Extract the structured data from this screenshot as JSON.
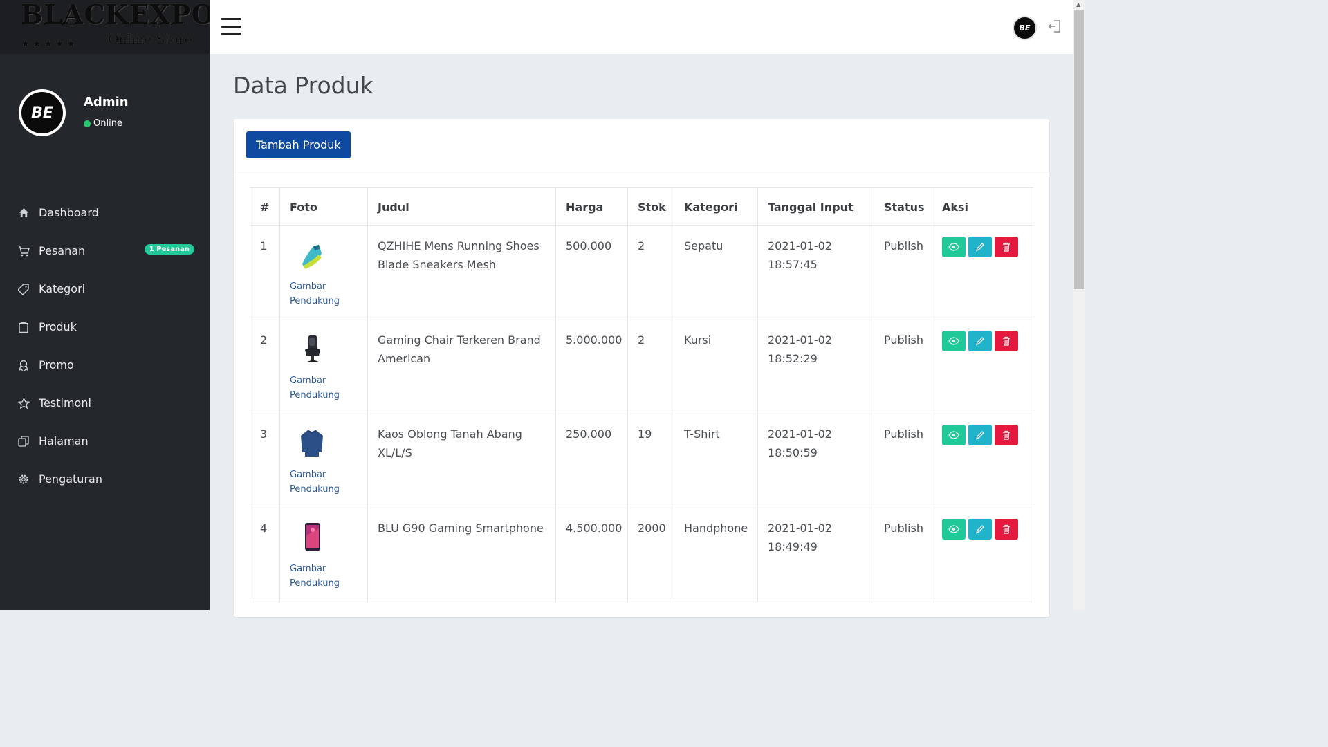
{
  "brand": {
    "main": "BLACKEXPO",
    "stars": "★★★★★",
    "sub": "Online Store"
  },
  "user": {
    "name": "Admin",
    "status": "Online",
    "avatar_text": "BE"
  },
  "nav": [
    {
      "label": "Dashboard",
      "icon": "home-icon"
    },
    {
      "label": "Pesanan",
      "icon": "cart-icon",
      "badge": "1 Pesanan"
    },
    {
      "label": "Kategori",
      "icon": "tag-icon"
    },
    {
      "label": "Produk",
      "icon": "clipboard-icon"
    },
    {
      "label": "Promo",
      "icon": "award-icon"
    },
    {
      "label": "Testimoni",
      "icon": "star-icon"
    },
    {
      "label": "Halaman",
      "icon": "pages-icon"
    },
    {
      "label": "Pengaturan",
      "icon": "gear-icon"
    }
  ],
  "topbar": {
    "avatar_text": "BE"
  },
  "page": {
    "title": "Data Produk",
    "add_button": "Tambah Produk"
  },
  "table": {
    "headers": [
      "#",
      "Foto",
      "Judul",
      "Harga",
      "Stok",
      "Kategori",
      "Tanggal Input",
      "Status",
      "Aksi"
    ],
    "link_label_1": "Gambar",
    "link_label_2": "Pendukung",
    "rows": [
      {
        "no": "1",
        "judul": "QZHIHE Mens Running Shoes Blade Sneakers Mesh",
        "harga": "500.000",
        "stok": "2",
        "kategori": "Sepatu",
        "tanggal": "2021-01-02",
        "jam": "18:57:45",
        "status": "Publish"
      },
      {
        "no": "2",
        "judul": "Gaming Chair Terkeren Brand American",
        "harga": "5.000.000",
        "stok": "2",
        "kategori": "Kursi",
        "tanggal": "2021-01-02",
        "jam": "18:52:29",
        "status": "Publish"
      },
      {
        "no": "3",
        "judul": "Kaos Oblong Tanah Abang XL/L/S",
        "harga": "250.000",
        "stok": "19",
        "kategori": "T-Shirt",
        "tanggal": "2021-01-02",
        "jam": "18:50:59",
        "status": "Publish"
      },
      {
        "no": "4",
        "judul": "BLU G90 Gaming Smartphone",
        "harga": "4.500.000",
        "stok": "2000",
        "kategori": "Handphone",
        "tanggal": "2021-01-02",
        "jam": "18:49:49",
        "status": "Publish"
      }
    ]
  },
  "colors": {
    "sidebar": "#24272b",
    "primary": "#0f4aa0",
    "view": "#20c997",
    "edit": "#21b3c9",
    "delete": "#e5193f",
    "badge": "#20c997"
  }
}
